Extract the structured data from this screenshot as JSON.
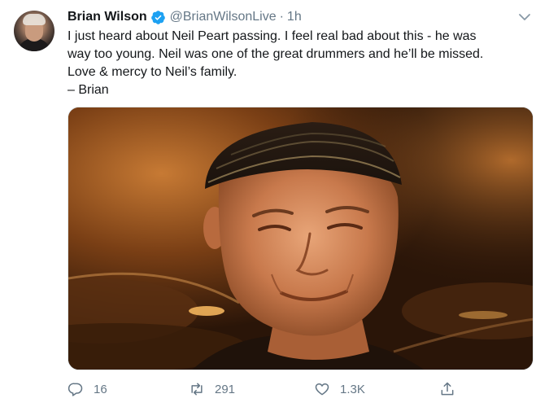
{
  "tweet": {
    "display_name": "Brian Wilson",
    "handle": "@BrianWilsonLive",
    "separator": "·",
    "time": "1h",
    "text_lines": [
      "I just heard about Neil Peart passing. I feel real bad about this - he was",
      "way too young. Neil was one of the great drummers and he’ll be missed.",
      "Love & mercy to Neil’s family.",
      "– Brian"
    ],
    "media": {
      "icon": "photo"
    },
    "actions": {
      "reply_count": "16",
      "retweet_count": "291",
      "like_count": "1.3K"
    }
  },
  "colors": {
    "verified": "#1da1f2",
    "secondary_text": "#657786",
    "primary_text": "#14171a"
  },
  "icons": {
    "verified": "verified-badge-icon",
    "caret": "chevron-down-icon",
    "reply": "reply-icon",
    "retweet": "retweet-icon",
    "like": "heart-icon",
    "share": "share-icon"
  }
}
